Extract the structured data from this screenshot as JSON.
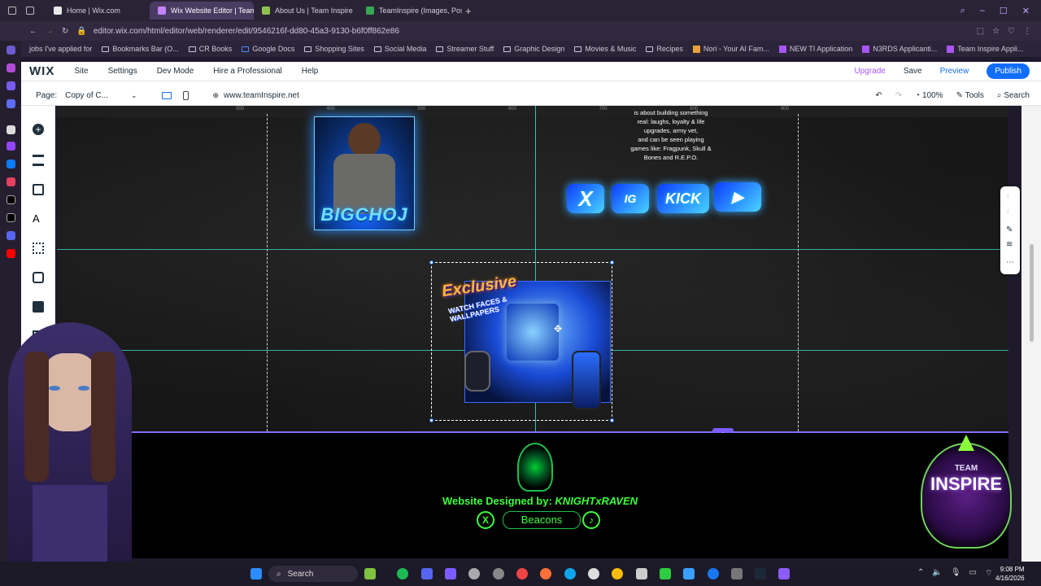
{
  "browser": {
    "tabs": [
      {
        "label": "Home | Wix.com",
        "active": false
      },
      {
        "label": "Wix Website Editor | Team",
        "active": true
      },
      {
        "label": "About Us | Team Inspire",
        "active": false
      },
      {
        "label": "TeamInspire (Images, Pos",
        "active": false
      }
    ],
    "url": "editor.wix.com/html/editor/web/renderer/edit/9546216f-dd80-45a3-9130-b6f0ff862e86",
    "bookmarks": [
      "jobs I've applied for",
      "Bookmarks Bar (O...",
      "CR Books",
      "Google Docs",
      "Shopping Sites",
      "Social Media",
      "Streamer Stuff",
      "Graphic Design",
      "Movies & Music",
      "Recipes",
      "Nori - Your AI Fam...",
      "NEW TI Application",
      "N3RDS Applicanti...",
      "Team Inspire Appli..."
    ]
  },
  "wix": {
    "logo": "WIX",
    "menu": [
      "Site",
      "Settings",
      "Dev Mode",
      "Hire a Professional",
      "Help"
    ],
    "upgrade": "Upgrade",
    "save": "Save",
    "preview": "Preview",
    "publish": "Publish",
    "page_label": "Page:",
    "page_value": "Copy of C...",
    "domain": "www.teamInspire.net",
    "zoom": "100%",
    "tools": "Tools",
    "search": "Search"
  },
  "canvas": {
    "ruler": [
      "300",
      "400",
      "500",
      "600",
      "700",
      "800",
      "900"
    ],
    "bio_lines": [
      "is about building something",
      "real: laughs, loyalty & life",
      "upgrades, army vet,",
      "and can be seen playing",
      "games like: Fragpunk, Skull &",
      "Bones and R.E.P.O."
    ],
    "profile_name": "BIGCHOJ",
    "socials": [
      "X",
      "IG",
      "KICK",
      "▶"
    ],
    "promo_title": "Exclusive",
    "promo_subtitle": "WATCH FACES & WALLPAPERS",
    "footer_credit": "Website Designed by: ",
    "footer_designer": "KNIGHTxRAVEN",
    "beacons": "Beacons",
    "team_logo_1": "TEAM",
    "team_logo_2": "INSPIRE"
  },
  "taskbar": {
    "search": "Search",
    "time": "9:08 PM",
    "date": "4/16/2026"
  },
  "colors": {
    "wix_blue": "#116dff",
    "guide": "#3ad1c8",
    "footer_green": "#3cff3c",
    "browser_bg": "#2a2336"
  }
}
